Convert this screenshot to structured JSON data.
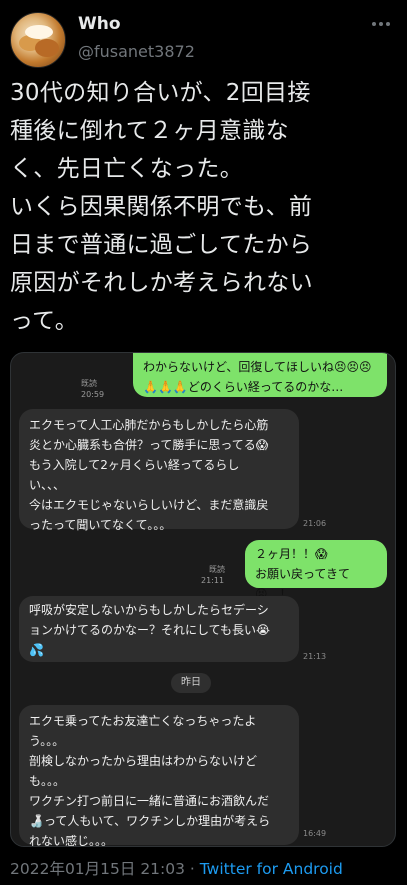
{
  "user": {
    "name": "Who",
    "handle": "@fusanet3872"
  },
  "tweet": {
    "text": "30代の知り合いが、2回目接\n種後に倒れて２ヶ月意識な\nく、先日亡くなった。\nいくら因果関係不明でも、前\n日まで普通に過ごしてたから\n原因がそれしか考えられない\nって。"
  },
  "chat": {
    "messages": [
      {
        "side": "out",
        "text": "わからないけど、回復してほしいね😣😣😣\n🙏🙏🙏どのくらい経ってるのかな…",
        "read": "既読",
        "time": "20:59"
      },
      {
        "side": "in",
        "text": "エクモって人工心肺だからもしかしたら心筋\n炎とか心臓系も合併？って勝手に思ってる😱\nもう入院して2ヶ月くらい経ってるらし\nい、、、\n今はエクモじゃないらしいけど、まだ意識戻\nったって聞いてなくて。。。",
        "time": "21:06"
      },
      {
        "side": "out",
        "text": "２ヶ月！！😱\nお願い戻ってきて😣…！",
        "read": "既読",
        "time": "21:11"
      },
      {
        "side": "in",
        "text": "呼吸が安定しないからもしかしたらセデーシ\nョンかけてるのかなー？それにしても長い😭\n💦",
        "time": "21:13"
      },
      {
        "side": "in",
        "text": "エクモ乗ってたお友達亡くなっちゃったよ\nう。。。\n剖検しなかったから理由はわからないけど\nも。。。\nワクチン打つ前日に一緒に普通にお酒飲んだ\n🍶って人もいて、ワクチンしか理由が考えら\nれない感じ。。。",
        "time": "16:49"
      }
    ],
    "date_divider": "昨日"
  },
  "footer": {
    "datetime": "2022年01月15日 21:03",
    "separator": " · ",
    "source": "Twitter for Android"
  },
  "colors": {
    "bubble_out": "#7ee26a",
    "bubble_in": "#2e2e2e",
    "link": "#1d9bf0"
  }
}
